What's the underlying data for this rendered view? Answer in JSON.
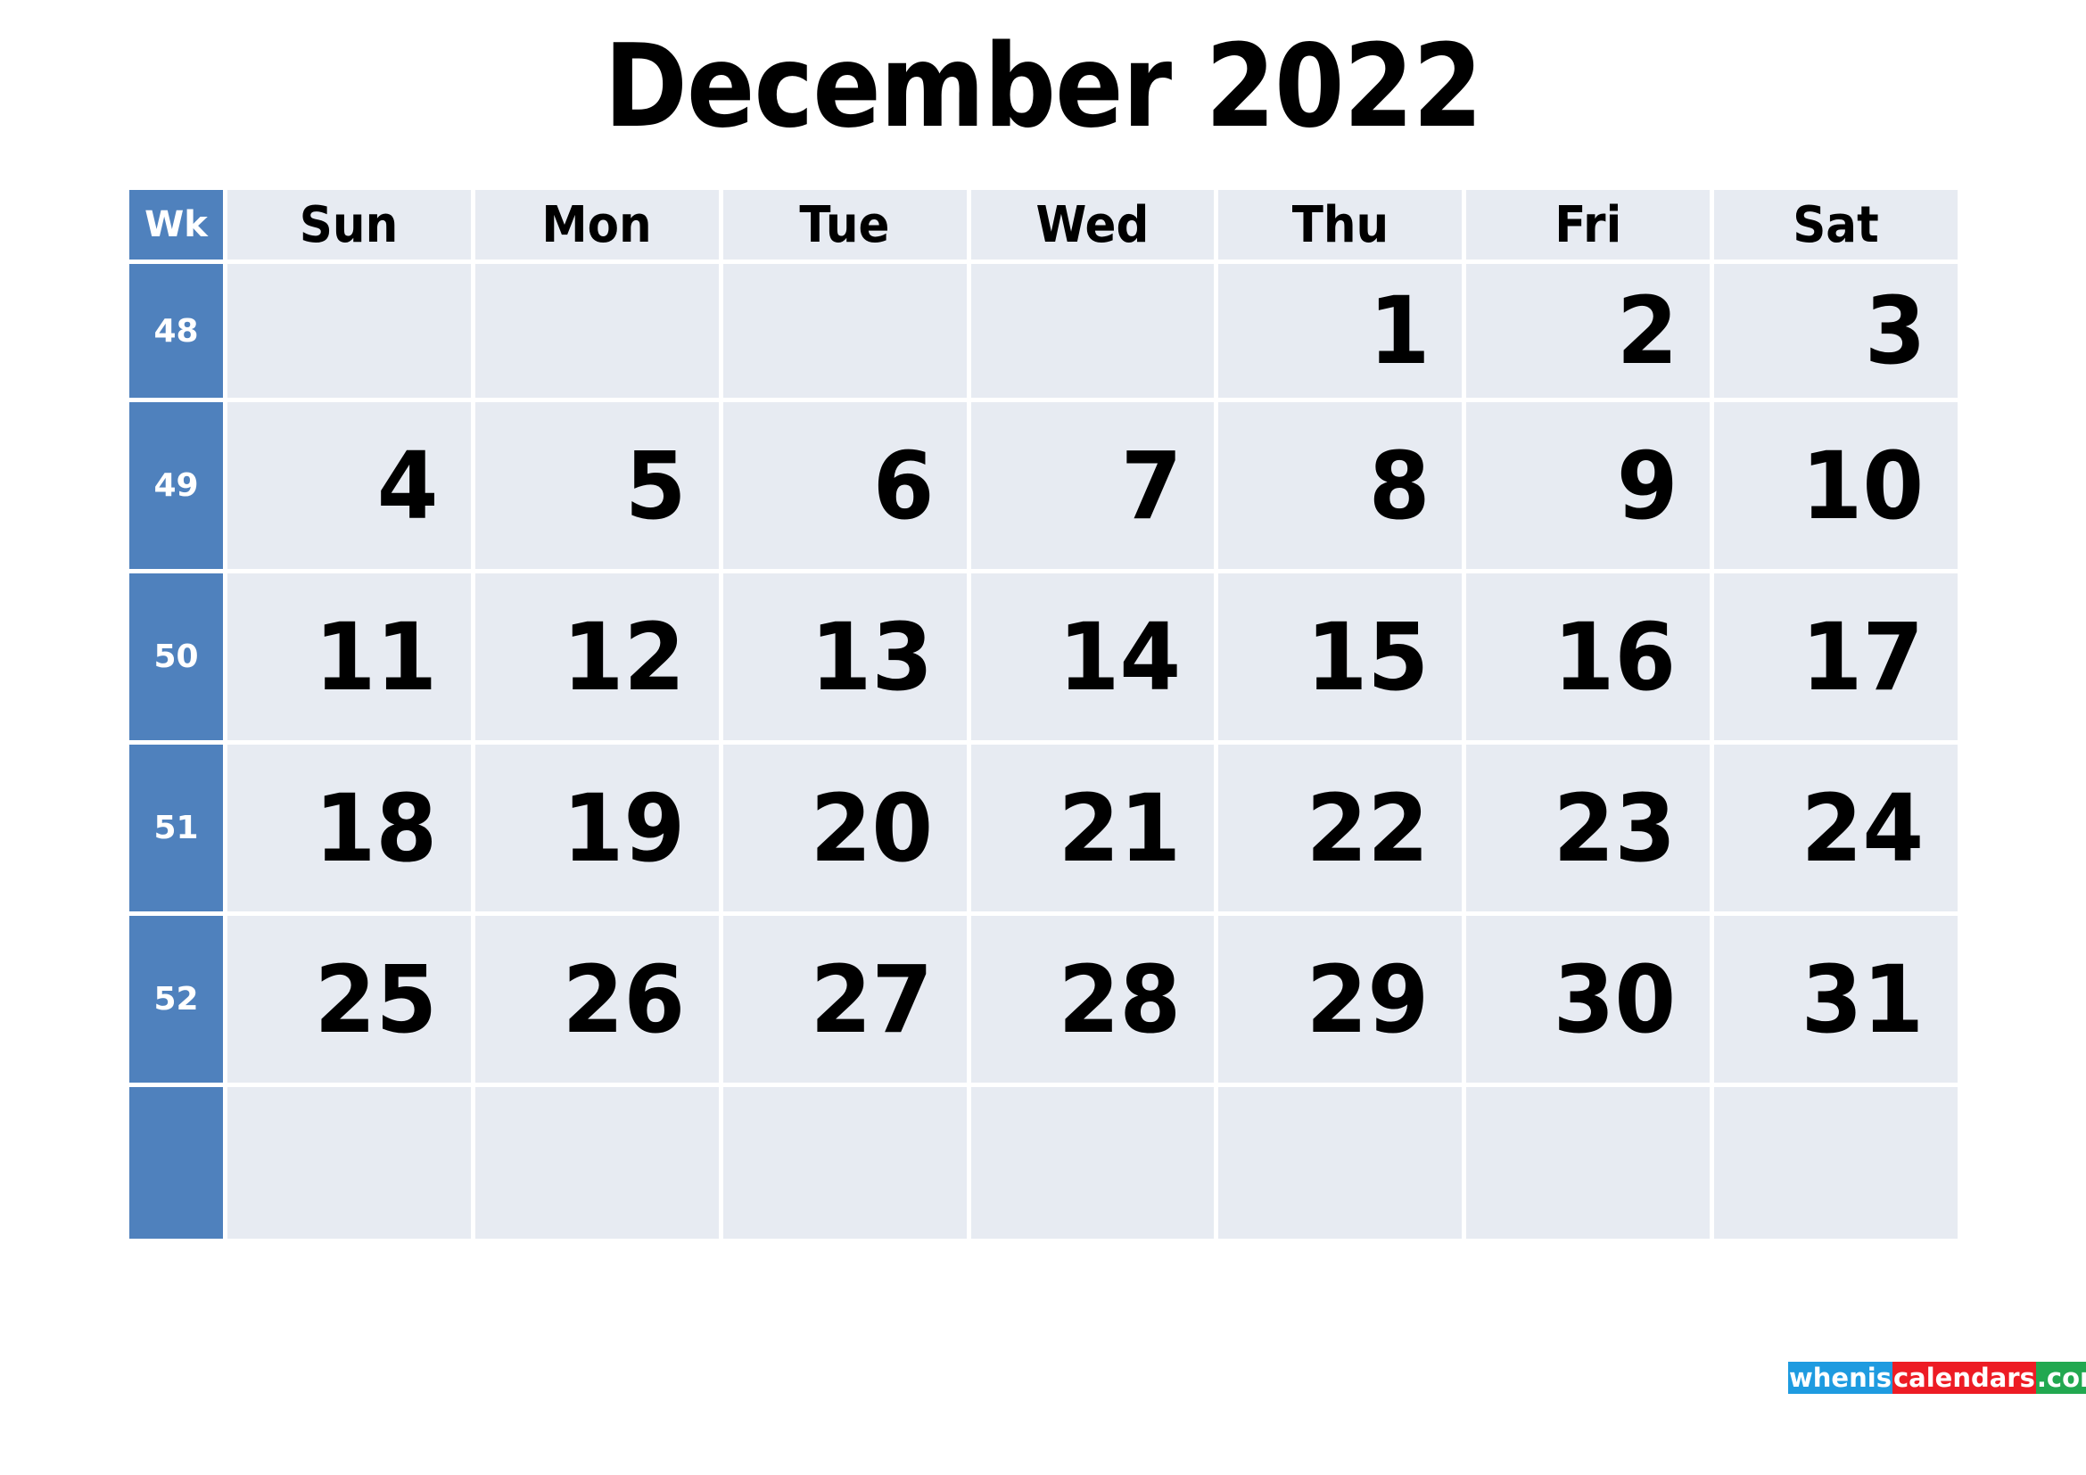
{
  "title": "December 2022",
  "colors": {
    "week_column_bg": "#4f81bd",
    "day_cell_bg": "#e7ebf2",
    "text": "#000000",
    "week_text": "#ffffff",
    "page_bg": "#ffffff",
    "logo_blue": "#1e9be0",
    "logo_red": "#ed1c24",
    "logo_green": "#22a850"
  },
  "header": {
    "week_label": "Wk",
    "days": [
      "Sun",
      "Mon",
      "Tue",
      "Wed",
      "Thu",
      "Fri",
      "Sat"
    ]
  },
  "weeks": [
    {
      "week": "48",
      "days": [
        "",
        "",
        "",
        "",
        "1",
        "2",
        "3"
      ]
    },
    {
      "week": "49",
      "days": [
        "4",
        "5",
        "6",
        "7",
        "8",
        "9",
        "10"
      ]
    },
    {
      "week": "50",
      "days": [
        "11",
        "12",
        "13",
        "14",
        "15",
        "16",
        "17"
      ]
    },
    {
      "week": "51",
      "days": [
        "18",
        "19",
        "20",
        "21",
        "22",
        "23",
        "24"
      ]
    },
    {
      "week": "52",
      "days": [
        "25",
        "26",
        "27",
        "28",
        "29",
        "30",
        "31"
      ]
    },
    {
      "week": "",
      "days": [
        "",
        "",
        "",
        "",
        "",
        "",
        ""
      ]
    }
  ],
  "footer": {
    "logo": {
      "part_blue": "whenis",
      "part_red": "calendars",
      "part_green": ".com"
    }
  }
}
